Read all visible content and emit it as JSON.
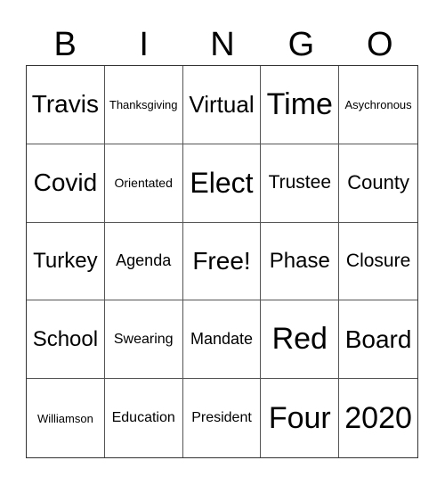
{
  "header": [
    "B",
    "I",
    "N",
    "G",
    "O"
  ],
  "cells": [
    [
      "Travis",
      "Thanksgiving",
      "Virtual",
      "Time",
      "Asychronous"
    ],
    [
      "Covid",
      "Orientated",
      "Elect",
      "Trustee",
      "County"
    ],
    [
      "Turkey",
      "Agenda",
      "Free!",
      "Phase",
      "Closure"
    ],
    [
      "School",
      "Swearing",
      "Mandate",
      "Red",
      "Board"
    ],
    [
      "Williamson",
      "Education",
      "President",
      "Four",
      "2020"
    ]
  ]
}
